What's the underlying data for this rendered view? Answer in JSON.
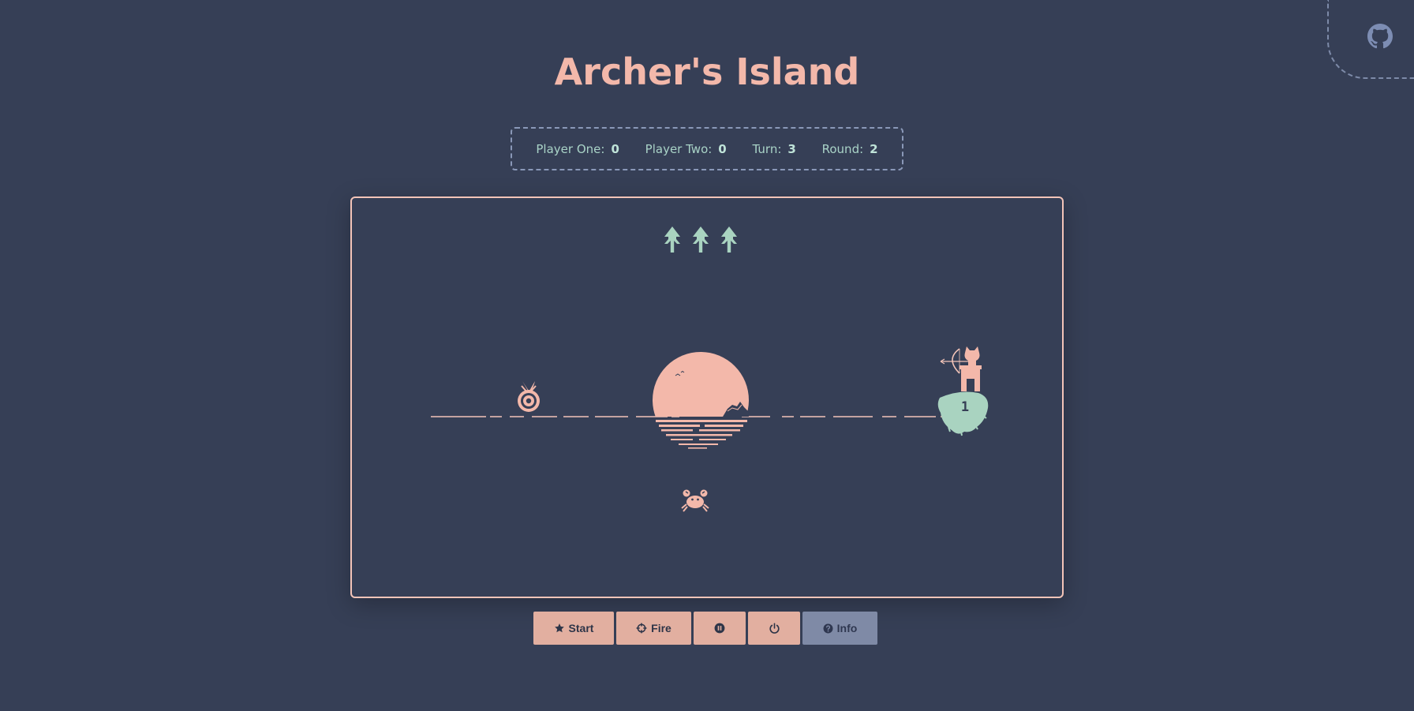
{
  "title": "Archer's Island",
  "scoreboard": {
    "player_one": {
      "label": "Player One:",
      "value": "0"
    },
    "player_two": {
      "label": "Player Two:",
      "value": "0"
    },
    "turn": {
      "label": "Turn:",
      "value": "3"
    },
    "round": {
      "label": "Round:",
      "value": "2"
    }
  },
  "game": {
    "arrows_remaining": 3,
    "island_number": "1",
    "colors": {
      "background": "#363f56",
      "accent_pink": "#f3b8aa",
      "accent_green": "#a9d3c0",
      "board_border": "#f3c4b8"
    }
  },
  "controls": {
    "start_label": "Start",
    "fire_label": "Fire",
    "pause_icon": "pause-icon",
    "power_icon": "power-icon",
    "info_label": "Info"
  },
  "links": {
    "github_icon": "github-icon"
  }
}
